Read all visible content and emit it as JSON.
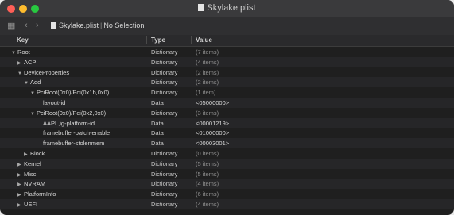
{
  "window": {
    "title": "Skylake.plist"
  },
  "toolbar": {
    "file": "Skylake.plist",
    "separator": "|",
    "selection": "No Selection"
  },
  "columns": {
    "key": "Key",
    "type": "Type",
    "value": "Value"
  },
  "rows": [
    {
      "indent": 0,
      "disclosure": "open",
      "key": "Root",
      "type": "Dictionary",
      "value": "(7 items)"
    },
    {
      "indent": 1,
      "disclosure": "closed",
      "key": "ACPI",
      "type": "Dictionary",
      "value": "(4 items)"
    },
    {
      "indent": 1,
      "disclosure": "open",
      "key": "DeviceProperties",
      "type": "Dictionary",
      "value": "(2 items)"
    },
    {
      "indent": 2,
      "disclosure": "open",
      "key": "Add",
      "type": "Dictionary",
      "value": "(2 items)"
    },
    {
      "indent": 3,
      "disclosure": "open",
      "key": "PciRoot(0x0)/Pci(0x1b,0x0)",
      "type": "Dictionary",
      "value": "(1 item)"
    },
    {
      "indent": 4,
      "disclosure": "none",
      "key": "layout-id",
      "type": "Data",
      "value": "<05000000>"
    },
    {
      "indent": 3,
      "disclosure": "open",
      "key": "PciRoot(0x0)/Pci(0x2,0x0)",
      "type": "Dictionary",
      "value": "(3 items)"
    },
    {
      "indent": 4,
      "disclosure": "none",
      "key": "AAPL,ig-platform-id",
      "type": "Data",
      "value": "<00001219>"
    },
    {
      "indent": 4,
      "disclosure": "none",
      "key": "framebuffer-patch-enable",
      "type": "Data",
      "value": "<01000000>"
    },
    {
      "indent": 4,
      "disclosure": "none",
      "key": "framebuffer-stolenmem",
      "type": "Data",
      "value": "<00003001>"
    },
    {
      "indent": 2,
      "disclosure": "closed",
      "key": "Block",
      "type": "Dictionary",
      "value": "(0 items)"
    },
    {
      "indent": 1,
      "disclosure": "closed",
      "key": "Kernel",
      "type": "Dictionary",
      "value": "(5 items)"
    },
    {
      "indent": 1,
      "disclosure": "closed",
      "key": "Misc",
      "type": "Dictionary",
      "value": "(5 items)"
    },
    {
      "indent": 1,
      "disclosure": "closed",
      "key": "NVRAM",
      "type": "Dictionary",
      "value": "(4 items)"
    },
    {
      "indent": 1,
      "disclosure": "closed",
      "key": "PlatformInfo",
      "type": "Dictionary",
      "value": "(6 items)"
    },
    {
      "indent": 1,
      "disclosure": "closed",
      "key": "UEFI",
      "type": "Dictionary",
      "value": "(4 items)"
    }
  ],
  "colors": {
    "background": "#1f1f1f",
    "titlebar": "#3a3a3c",
    "text": "#d8d8d8",
    "muted": "#8f8f8f"
  }
}
